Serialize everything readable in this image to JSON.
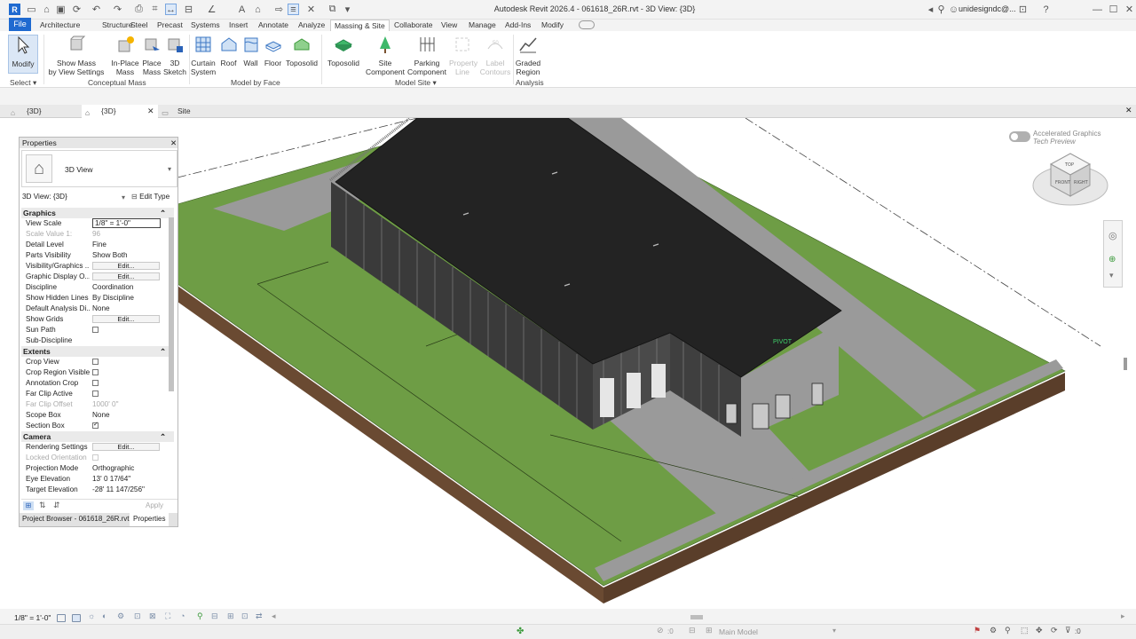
{
  "title": "Autodesk Revit 2026.4 - 061618_26R.rvt - 3D View: {3D}",
  "user": "unidesigndc@...",
  "qat_icons": [
    "revit-logo-icon",
    "open-icon",
    "save-icon",
    "sync-icon",
    "undo-icon",
    "redo-icon",
    "print-icon",
    "measure-icon",
    "dimension-icon",
    "text-icon",
    "3d-view-icon",
    "section-icon",
    "thin-lines-icon",
    "close-hidden-icon",
    "switch-windows-icon"
  ],
  "menu": {
    "file": "File",
    "items": [
      "Architecture",
      "Structure",
      "Steel",
      "Precast",
      "Systems",
      "Insert",
      "Annotate",
      "Analyze",
      "Massing & Site",
      "Collaborate",
      "View",
      "Manage",
      "Add-Ins",
      "Modify"
    ],
    "active": "Massing & Site"
  },
  "ribbon": {
    "modify": "Modify",
    "select": "Select",
    "conceptual_mass": {
      "label": "Conceptual Mass",
      "buttons": [
        {
          "l1": "Show Mass",
          "l2": "by View Settings"
        },
        {
          "l1": "In-Place",
          "l2": "Mass"
        },
        {
          "l1": "Place",
          "l2": "Mass"
        },
        {
          "l1": "3D",
          "l2": "Sketch"
        }
      ]
    },
    "model_by_face": {
      "label": "Model by Face",
      "buttons": [
        {
          "l1": "Curtain",
          "l2": "System"
        },
        {
          "l1": "Roof",
          "l2": ""
        },
        {
          "l1": "Wall",
          "l2": ""
        },
        {
          "l1": "Floor",
          "l2": ""
        },
        {
          "l1": "Toposolid",
          "l2": ""
        }
      ]
    },
    "model_site": {
      "label": "Model Site",
      "buttons": [
        {
          "l1": "Toposolid",
          "l2": ""
        },
        {
          "l1": "Site",
          "l2": "Component"
        },
        {
          "l1": "Parking",
          "l2": "Component"
        },
        {
          "l1": "Property",
          "l2": "Line"
        },
        {
          "l1": "Label",
          "l2": "Contours"
        }
      ]
    },
    "analysis": {
      "label": "Analysis",
      "buttons": [
        {
          "l1": "Graded",
          "l2": "Region"
        }
      ]
    }
  },
  "tabs": [
    {
      "label": "{3D}",
      "active": false
    },
    {
      "label": "{3D}",
      "active": true
    },
    {
      "label": "Site",
      "active": false
    }
  ],
  "properties": {
    "title": "Properties",
    "type_name": "3D View",
    "instance": "3D View: {3D}",
    "edit_type": "Edit Type",
    "sections": {
      "graphics": "Graphics",
      "extents": "Extents",
      "camera": "Camera"
    },
    "rows": [
      {
        "k": "View Scale",
        "v": "1/8\" = 1'-0\""
      },
      {
        "k": "Scale Value    1:",
        "v": "96"
      },
      {
        "k": "Detail Level",
        "v": "Fine"
      },
      {
        "k": "Parts Visibility",
        "v": "Show Both"
      },
      {
        "k": "Visibility/Graphics ...",
        "v": "Edit..."
      },
      {
        "k": "Graphic Display O...",
        "v": "Edit..."
      },
      {
        "k": "Discipline",
        "v": "Coordination"
      },
      {
        "k": "Show Hidden Lines",
        "v": "By Discipline"
      },
      {
        "k": "Default Analysis Di...",
        "v": "None"
      },
      {
        "k": "Show Grids",
        "v": "Edit..."
      },
      {
        "k": "Sun Path",
        "v": ""
      },
      {
        "k": "Sub-Discipline",
        "v": ""
      },
      {
        "k": "Crop View",
        "v": ""
      },
      {
        "k": "Crop Region Visible",
        "v": ""
      },
      {
        "k": "Annotation Crop",
        "v": ""
      },
      {
        "k": "Far Clip Active",
        "v": ""
      },
      {
        "k": "Far Clip Offset",
        "v": "1000'  0\""
      },
      {
        "k": "Scope Box",
        "v": "None"
      },
      {
        "k": "Section Box",
        "v": ""
      },
      {
        "k": "Rendering Settings",
        "v": "Edit..."
      },
      {
        "k": "Locked Orientation",
        "v": ""
      },
      {
        "k": "Projection Mode",
        "v": "Orthographic"
      },
      {
        "k": "Eye Elevation",
        "v": "13'  0 17/64\""
      },
      {
        "k": "Target Elevation",
        "v": "-28'  11 147/256\""
      }
    ],
    "apply": "Apply",
    "footer_tabs": [
      "Project Browser - 061618_26R.rvt",
      "Properties"
    ]
  },
  "accel": {
    "line1": "Accelerated Graphics",
    "line2": "Tech Preview"
  },
  "viewcube": {
    "top": "TOP",
    "front": "FRONT",
    "right": "RIGHT"
  },
  "building_label": "PIVOT",
  "status": {
    "scale": "1/8\" = 1'-0\"",
    "select_count": ":0",
    "model": "Main Model",
    "filter_count": ":0"
  },
  "colors": {
    "grass": "#6e9d45",
    "roof": "#232323",
    "accent": "#1f6ad0",
    "paving": "#999999"
  }
}
